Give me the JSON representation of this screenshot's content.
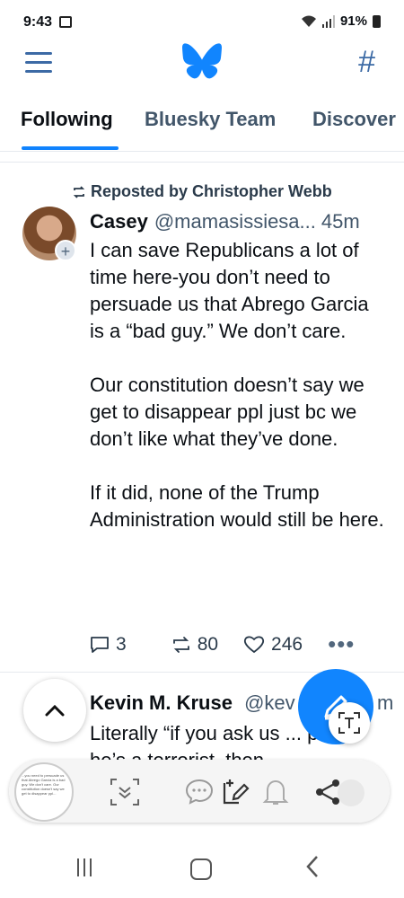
{
  "status": {
    "time": "9:43",
    "battery": "91%"
  },
  "tabs": [
    {
      "label": "Following",
      "active": true
    },
    {
      "label": "Bluesky Team",
      "active": false
    },
    {
      "label": "Discover",
      "active": false
    }
  ],
  "post": {
    "repost_label": "Reposted by Christopher Webb",
    "author": "Casey",
    "handle": "@mamasissiesa...",
    "time": "45m",
    "paragraphs": [
      "I can save Republicans a lot of time here-you don’t need to persuade us that Abrego Garcia is a “bad guy.” We don’t care.",
      "Our constitution doesn’t say we get to disappear ppl just bc we don’t like what they’ve done.",
      "If it did, none of the Trump Administration would still be here."
    ],
    "replies": "3",
    "reposts": "80",
    "likes": "246",
    "more": "•••"
  },
  "post2": {
    "author": "Kevin M. Kruse",
    "handle": "@kev",
    "time_partial": "m",
    "text": "Literally “if you ask us ... prove he’s a terrorist, then"
  },
  "thumbnail_text": "...you need to persuade us that Abrego Garcia is a bad guy. We don't care. Our constitution doesn't say we get to disappear ppl...",
  "colors": {
    "accent": "#1185fe",
    "icon_blue": "#3c6aa5"
  },
  "icons": [
    "menu-icon",
    "butterfly-logo",
    "hashtag-icon",
    "repost-icon",
    "reply-icon",
    "like-icon",
    "more-icon",
    "chevron-up-icon",
    "compose-icon",
    "text-extract-icon",
    "scan-icon",
    "chat-icon",
    "edit-icon",
    "bell-icon",
    "share-icon"
  ]
}
